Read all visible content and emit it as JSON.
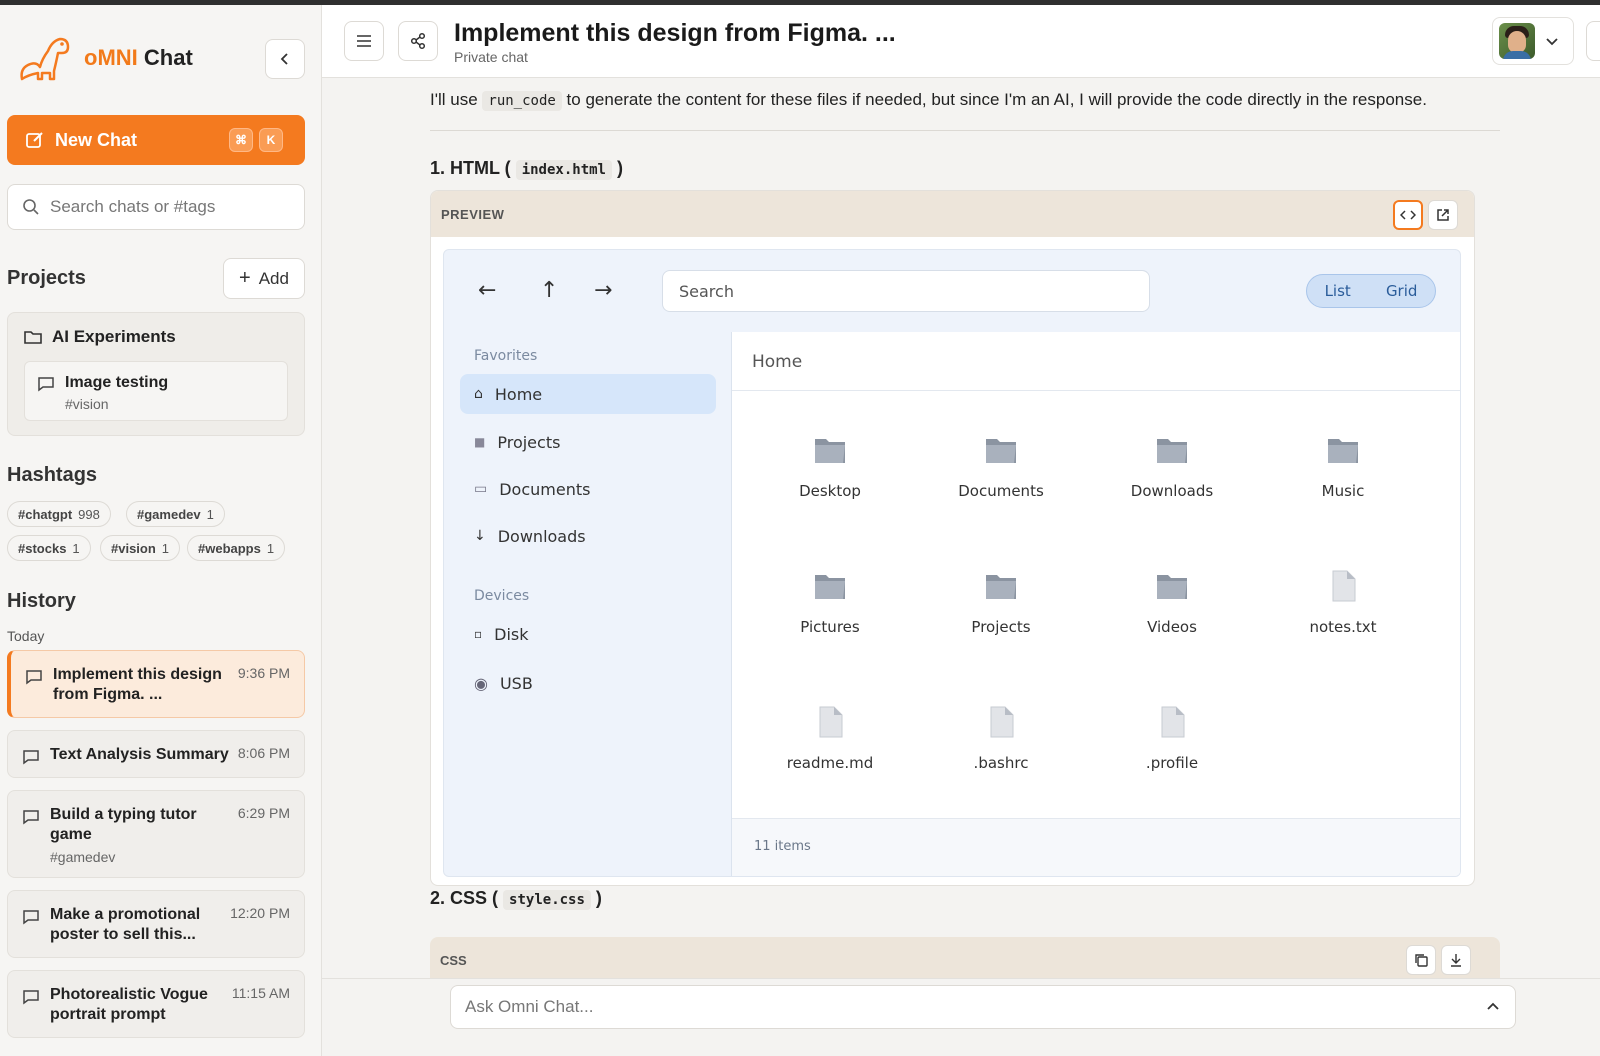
{
  "sidebar": {
    "brand_accent": "oMNI",
    "brand_rest": " Chat",
    "new_chat_label": "New Chat",
    "kbd1": "⌘",
    "kbd2": "K",
    "search_placeholder": "Search chats or #tags",
    "projects_title": "Projects",
    "add_label": "Add",
    "project": {
      "name": "AI Experiments",
      "chat_title": "Image testing",
      "chat_tag": "#vision"
    },
    "hashtags_title": "Hashtags",
    "hashtags": [
      {
        "tag": "#chatgpt",
        "count": "998"
      },
      {
        "tag": "#gamedev",
        "count": "1"
      },
      {
        "tag": "#stocks",
        "count": "1"
      },
      {
        "tag": "#vision",
        "count": "1"
      },
      {
        "tag": "#webapps",
        "count": "1"
      }
    ],
    "history_title": "History",
    "today_label": "Today",
    "history": [
      {
        "title": "Implement this design from Figma. ...",
        "time": "9:36 PM",
        "tag": ""
      },
      {
        "title": "Text Analysis Summary",
        "time": "8:06 PM",
        "tag": ""
      },
      {
        "title": "Build a typing tutor game",
        "time": "6:29 PM",
        "tag": "#gamedev"
      },
      {
        "title": "Make a promotional poster to sell this...",
        "time": "12:20 PM",
        "tag": ""
      },
      {
        "title": "Photorealistic Vogue portrait prompt",
        "time": "11:15 AM",
        "tag": ""
      }
    ]
  },
  "header": {
    "title": "Implement this design from Figma. ...",
    "subtitle": "Private chat"
  },
  "main": {
    "intro_before": "I'll use ",
    "intro_code": "run_code",
    "intro_after": " to generate the content for these files if needed, but since I'm an AI, I will provide the code directly in the response.",
    "section1_prefix": "1. HTML (",
    "section1_code": "index.html",
    "section1_suffix": ")",
    "preview_label": "PREVIEW",
    "section2_prefix": "2. CSS (",
    "section2_code": "style.css",
    "section2_suffix": ")",
    "css_label": "CSS"
  },
  "file_manager": {
    "nav_back": "←",
    "nav_up": "↑",
    "nav_forward": "→",
    "search_placeholder": "Search",
    "view_list": "List",
    "view_grid": "Grid",
    "favorites_label": "Favorites",
    "favorites": [
      {
        "glyph": "⌂",
        "label": "Home"
      },
      {
        "glyph": "■",
        "label": "Projects"
      },
      {
        "glyph": "▭",
        "label": "Documents"
      },
      {
        "glyph": "↓",
        "label": "Downloads"
      }
    ],
    "devices_label": "Devices",
    "devices": [
      {
        "glyph": "▫",
        "label": "Disk"
      },
      {
        "glyph": "◉",
        "label": "USB"
      }
    ],
    "breadcrumb": "Home",
    "files": [
      {
        "name": "Desktop",
        "kind": "folder"
      },
      {
        "name": "Documents",
        "kind": "folder"
      },
      {
        "name": "Downloads",
        "kind": "folder"
      },
      {
        "name": "Music",
        "kind": "folder"
      },
      {
        "name": "Pictures",
        "kind": "folder"
      },
      {
        "name": "Projects",
        "kind": "folder"
      },
      {
        "name": "Videos",
        "kind": "folder"
      },
      {
        "name": "notes.txt",
        "kind": "file"
      },
      {
        "name": "readme.md",
        "kind": "file"
      },
      {
        "name": ".bashrc",
        "kind": "file"
      },
      {
        "name": ".profile",
        "kind": "file"
      }
    ],
    "item_count": "11 items"
  },
  "composer": {
    "placeholder": "Ask Omni Chat..."
  },
  "colors": {
    "accent": "#f47a1f",
    "active_blue": "#d6e6fa"
  }
}
